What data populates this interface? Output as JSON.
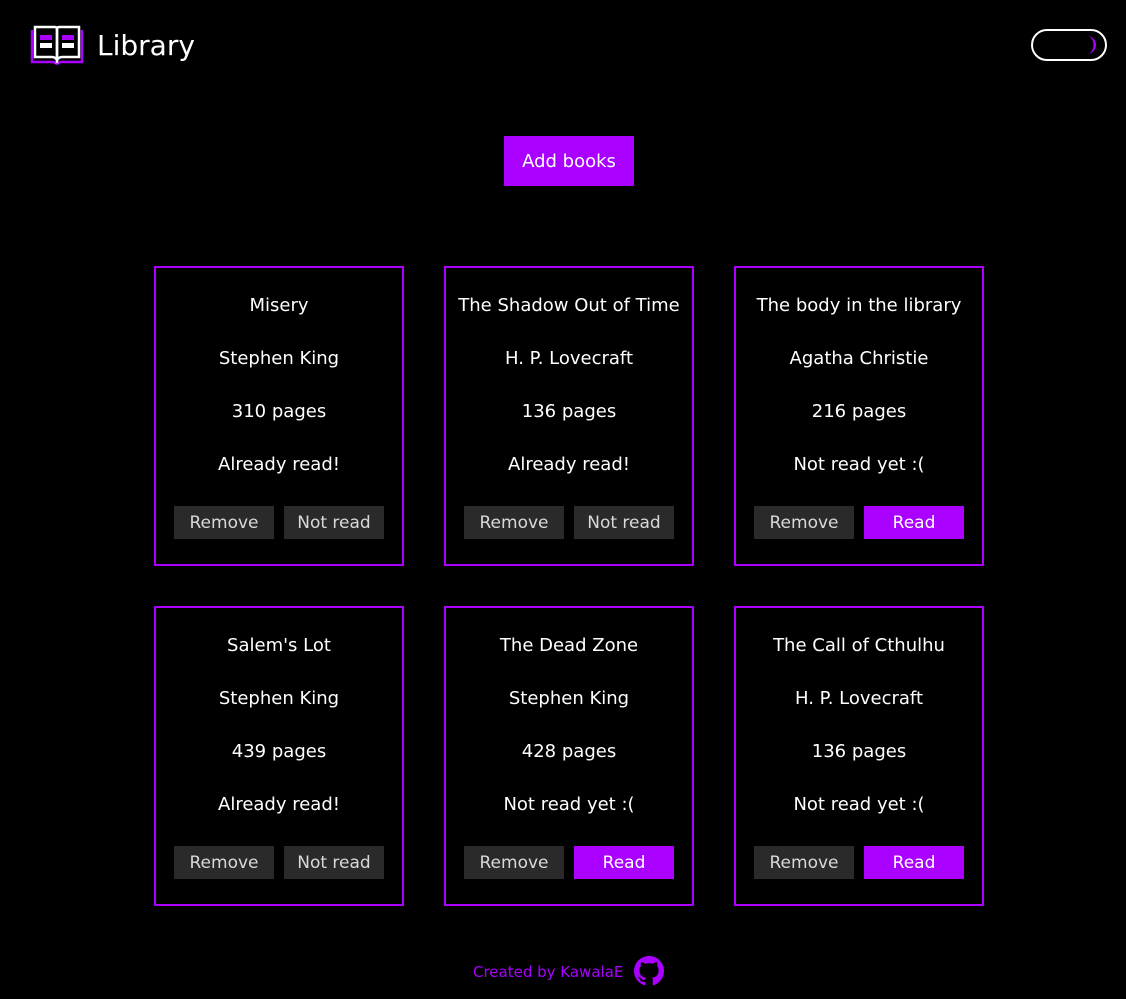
{
  "header": {
    "title": "Library",
    "logo_icon": "book-icon",
    "theme_toggle_icon": "moon-icon"
  },
  "actions": {
    "add_label": "Add books"
  },
  "books": [
    {
      "title": "Misery",
      "author": "Stephen King",
      "pages": "310 pages",
      "status": "Already read!",
      "remove_label": "Remove",
      "toggle_label": "Not read",
      "read": true
    },
    {
      "title": "The Shadow Out of Time",
      "author": "H. P. Lovecraft",
      "pages": "136 pages",
      "status": "Already read!",
      "remove_label": "Remove",
      "toggle_label": "Not read",
      "read": true
    },
    {
      "title": "The body in the library",
      "author": "Agatha Christie",
      "pages": "216 pages",
      "status": "Not read yet :(",
      "remove_label": "Remove",
      "toggle_label": "Read",
      "read": false
    },
    {
      "title": "Salem's Lot",
      "author": "Stephen King",
      "pages": "439 pages",
      "status": "Already read!",
      "remove_label": "Remove",
      "toggle_label": "Not read",
      "read": true
    },
    {
      "title": "The Dead Zone",
      "author": "Stephen King",
      "pages": "428 pages",
      "status": "Not read yet :(",
      "remove_label": "Remove",
      "toggle_label": "Read",
      "read": false
    },
    {
      "title": "The Call of Cthulhu",
      "author": "H. P. Lovecraft",
      "pages": "136 pages",
      "status": "Not read yet :(",
      "remove_label": "Remove",
      "toggle_label": "Read",
      "read": false
    }
  ],
  "footer": {
    "credit": "Created by KawalaE",
    "github_icon": "github-icon"
  },
  "colors": {
    "accent": "#a900ff",
    "background": "#000000",
    "button_gray": "#2a2a2a",
    "text": "#ffffff"
  }
}
